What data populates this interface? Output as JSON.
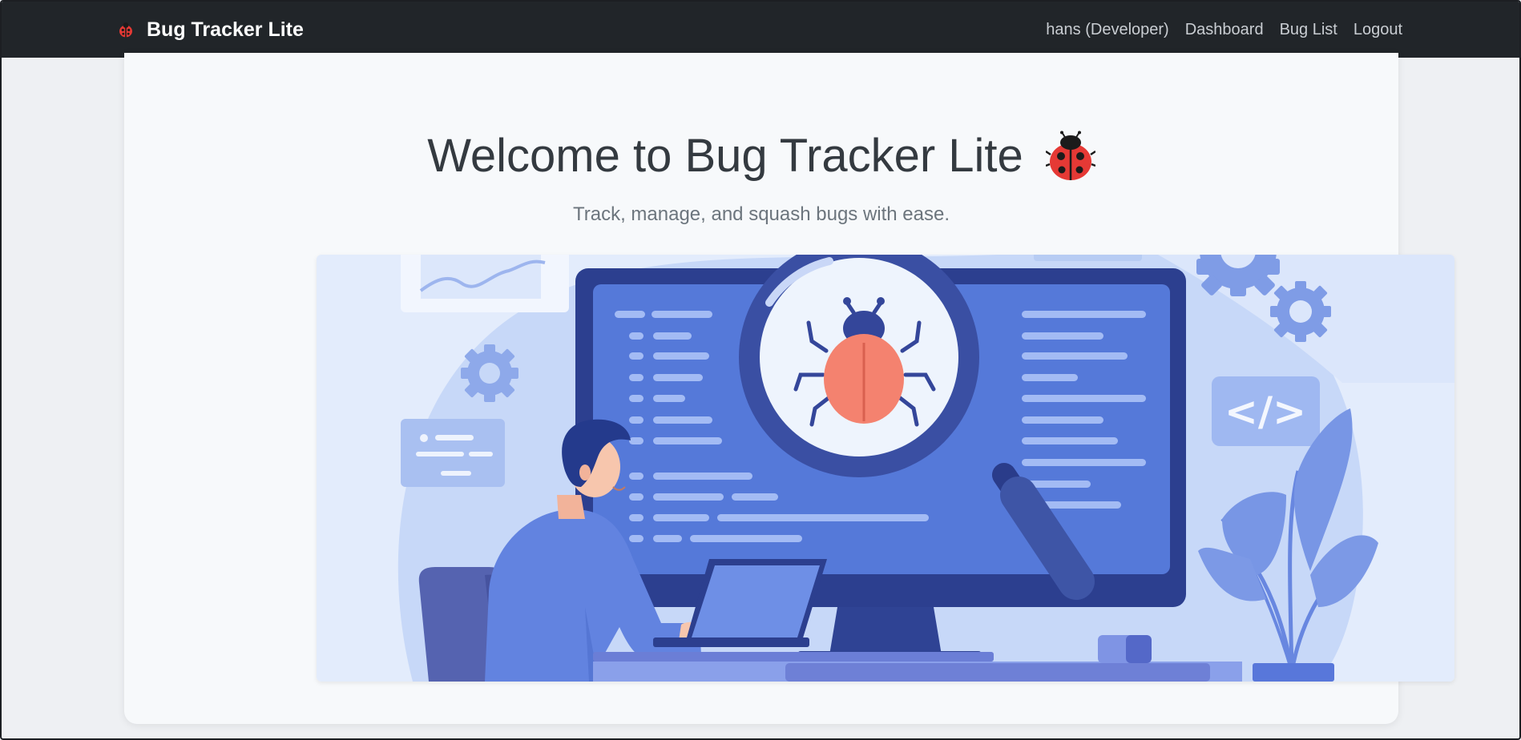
{
  "navbar": {
    "brand": "Bug Tracker Lite",
    "brand_icon": "ladybug-icon",
    "links": [
      "hans (Developer)",
      "Dashboard",
      "Bug List",
      "Logout"
    ]
  },
  "hero": {
    "title": "Welcome to Bug Tracker Lite",
    "title_icon": "ladybug-icon",
    "subtitle": "Track, manage, and squash bugs with ease.",
    "illustration": "developer-debugging-illustration",
    "code_tag": "</>"
  },
  "colors": {
    "navbar_bg": "#212529",
    "title": "#343a40",
    "subtitle": "#6c757d",
    "accent_blue": "#5b7fdc",
    "bug_red": "#e53935"
  }
}
